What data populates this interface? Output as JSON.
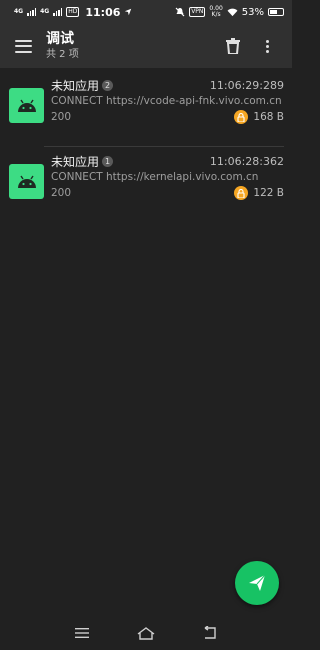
{
  "status_bar": {
    "sim1": "4G",
    "sim2": "4G",
    "hd": "HD",
    "time": "11:06",
    "vpn": "VPN",
    "speed_value": "0.00",
    "speed_unit": "K/s",
    "battery": "53%"
  },
  "app_bar": {
    "title": "调试",
    "subtitle": "共 2 项"
  },
  "requests": [
    {
      "app_name": "未知应用",
      "badge": "2",
      "time": "11:06:29:289",
      "url": "CONNECT https://vcode-api-fnk.vivo.com.cn",
      "status": "200",
      "size": "168 B"
    },
    {
      "app_name": "未知应用",
      "badge": "1",
      "time": "11:06:28:362",
      "url": "CONNECT https://kernelapi.vivo.com.cn",
      "status": "200",
      "size": "122 B"
    }
  ],
  "colors": {
    "android_green": "#3ddc84",
    "fab_green": "#17c264",
    "lock_orange": "#f5a623"
  },
  "icons": {
    "menu": "menu-icon",
    "delete": "trash-icon",
    "more": "more-vert-icon",
    "app": "android-icon",
    "secure": "lock-icon",
    "fab": "send-icon"
  }
}
